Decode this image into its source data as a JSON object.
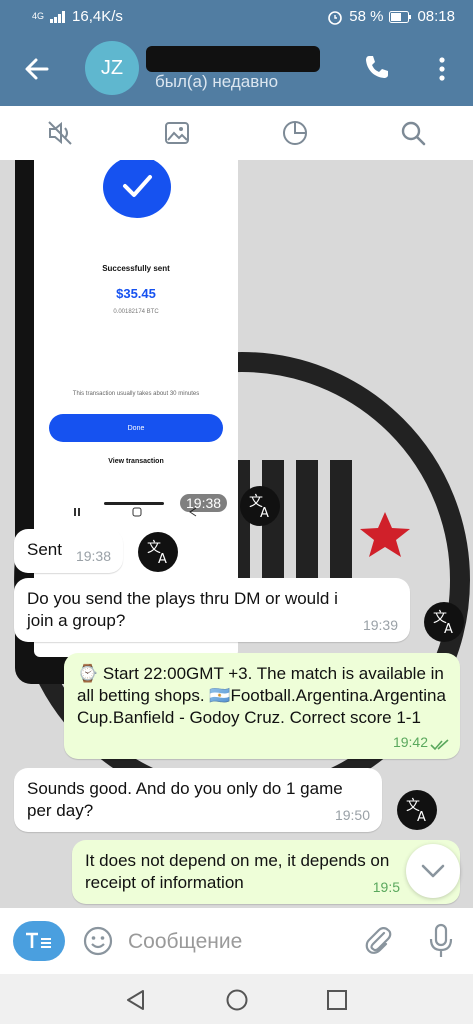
{
  "status_bar": {
    "network": "4G",
    "speed": "16,4K/s",
    "battery": "58 %",
    "time": "08:18"
  },
  "header": {
    "avatar_initials": "JZ",
    "subtitle": "был(а) недавно"
  },
  "toolbar": {
    "icons": [
      "mute-icon",
      "media-icon",
      "pie-chart-icon",
      "search-icon"
    ]
  },
  "image_message": {
    "title": "Successfully sent",
    "amount": "$35.45",
    "btc": "0.00182174 BTC",
    "note": "This transaction usually takes about 30 minutes",
    "done": "Done",
    "view": "View transaction",
    "time": "19:38"
  },
  "messages": [
    {
      "direction": "incoming",
      "text": "Sent",
      "time": "19:38"
    },
    {
      "direction": "incoming",
      "text": "Do you send the plays thru DM or would i join a group?",
      "time": "19:39"
    },
    {
      "direction": "outgoing",
      "text": "⌚ Start 22:00GMT +3. The match is available in all betting shops. 🇦🇷Football.Argentina.Argentina Cup.Banfield - Godoy Cruz. Correct score 1-1",
      "time": "19:42"
    },
    {
      "direction": "incoming",
      "text": "Sounds good. And do you only do 1 game per day?",
      "time": "19:50"
    },
    {
      "direction": "outgoing",
      "text": "It does not depend on me, it depends on receipt of information",
      "time": "19:5"
    }
  ],
  "input": {
    "placeholder": "Сообщение"
  },
  "colors": {
    "header": "#517da2",
    "outgoing_bubble": "#eefed8",
    "incoming_bubble": "#ffffff",
    "accent": "#4a9fdf"
  }
}
